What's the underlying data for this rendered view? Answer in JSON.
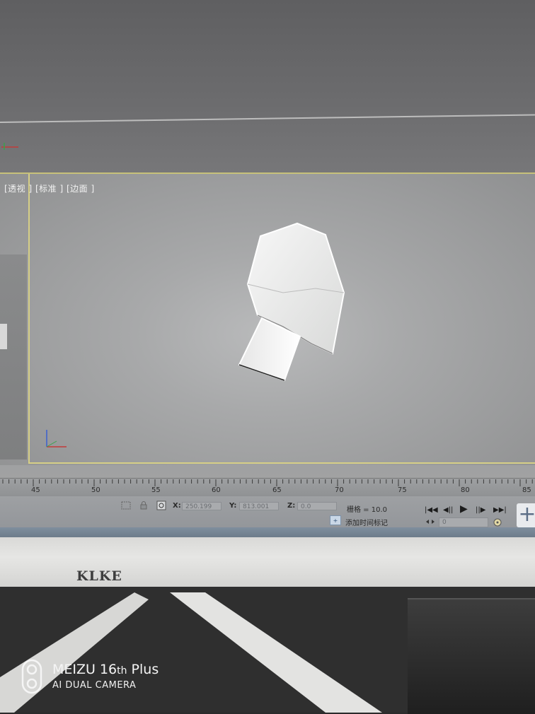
{
  "viewport": {
    "label": "[透视 ] [标准 ] [边面 ]"
  },
  "timeline": {
    "ticks": [
      "45",
      "50",
      "55",
      "60",
      "65",
      "70",
      "75",
      "80",
      "85"
    ]
  },
  "status": {
    "x_label": "X:",
    "x_value": "250.199",
    "y_label": "Y:",
    "y_value": "813.001",
    "z_label": "Z:",
    "z_value": "0.0",
    "grid_label": "栅格 = 10.0",
    "add_time_tag": "添加时间标记",
    "frame_value": "0",
    "playback": [
      "|◀◀",
      "◀||",
      "▶",
      "||▶",
      "▶▶|"
    ]
  },
  "monitor": {
    "brand": "KLKE"
  },
  "watermark": {
    "device": "MEIZU 16",
    "device_th": "th",
    "device_model": " Plus",
    "camera": "AI DUAL CAMERA"
  },
  "colors": {
    "viewport_border": "#d6cf86",
    "screen_bg": "#a5a6a7",
    "bezel": "#e6e6e4"
  }
}
